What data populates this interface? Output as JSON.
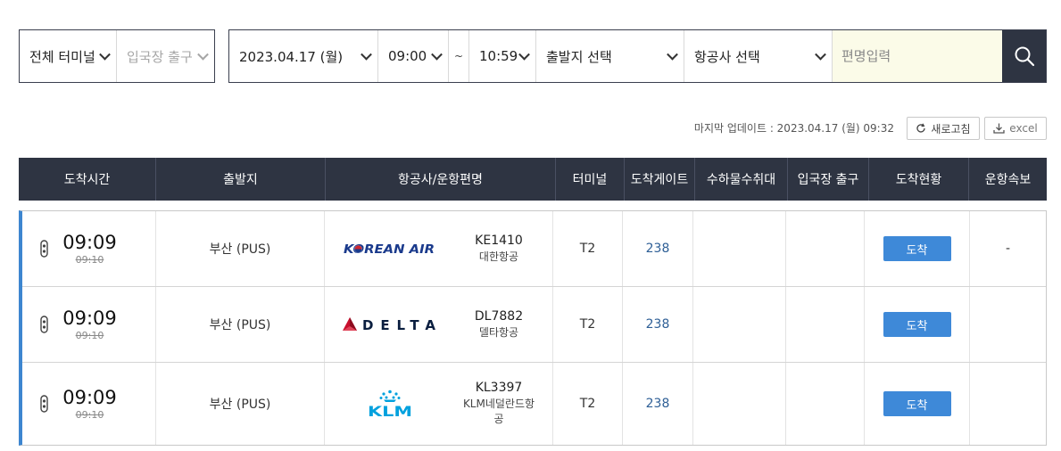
{
  "filters": {
    "terminal": "전체 터미널",
    "gate": "입국장 출구",
    "date": "2023.04.17 (월)",
    "time_from": "09:00",
    "tilde": "~",
    "time_to": "10:59",
    "origin": "출발지 선택",
    "airline": "항공사 선택",
    "flight_placeholder": "편명입력"
  },
  "update": {
    "label": "마지막 업데이트 : 2023.04.17 (월) 09:32",
    "refresh_label": "새로고침",
    "excel_label": "excel"
  },
  "table": {
    "headers": [
      "도착시간",
      "출발지",
      "항공사/운항편명",
      "터미널",
      "도착게이트",
      "수하물수취대",
      "입국장 출구",
      "도착현황",
      "운항속보"
    ],
    "rows": [
      {
        "actual_time": "09:09",
        "scheduled_time": "09:10",
        "origin": "부산 (PUS)",
        "logo": "korean-air-logo",
        "logo_text": "KOREAN AIR",
        "flight_no": "KE1410",
        "airline_name": "대한항공",
        "terminal": "T2",
        "gate": "238",
        "baggage": "",
        "exit": "",
        "status": "도착",
        "news": "-"
      },
      {
        "actual_time": "09:09",
        "scheduled_time": "09:10",
        "origin": "부산 (PUS)",
        "logo": "delta-logo",
        "logo_text": "DELTA",
        "flight_no": "DL7882",
        "airline_name": "델타항공",
        "terminal": "T2",
        "gate": "238",
        "baggage": "",
        "exit": "",
        "status": "도착",
        "news": ""
      },
      {
        "actual_time": "09:09",
        "scheduled_time": "09:10",
        "origin": "부산 (PUS)",
        "logo": "klm-logo",
        "logo_text": "KLM",
        "flight_no": "KL3397",
        "airline_name": "KLM네덜란드항공",
        "terminal": "T2",
        "gate": "238",
        "baggage": "",
        "exit": "",
        "status": "도착",
        "news": ""
      }
    ]
  },
  "colors": {
    "header_bg": "#2e3442",
    "accent_blue": "#3e89d8",
    "input_bg": "#fbfbe8",
    "korean_air_blue": "#1a3a8c",
    "korean_air_red": "#d0262f",
    "delta_red": "#c8102e",
    "delta_navy": "#0a1e3f",
    "klm_blue": "#00a1de"
  },
  "icons": {
    "search": "search-icon",
    "refresh": "refresh-icon",
    "download": "download-icon",
    "flight_status": "arrival-status-icon"
  }
}
